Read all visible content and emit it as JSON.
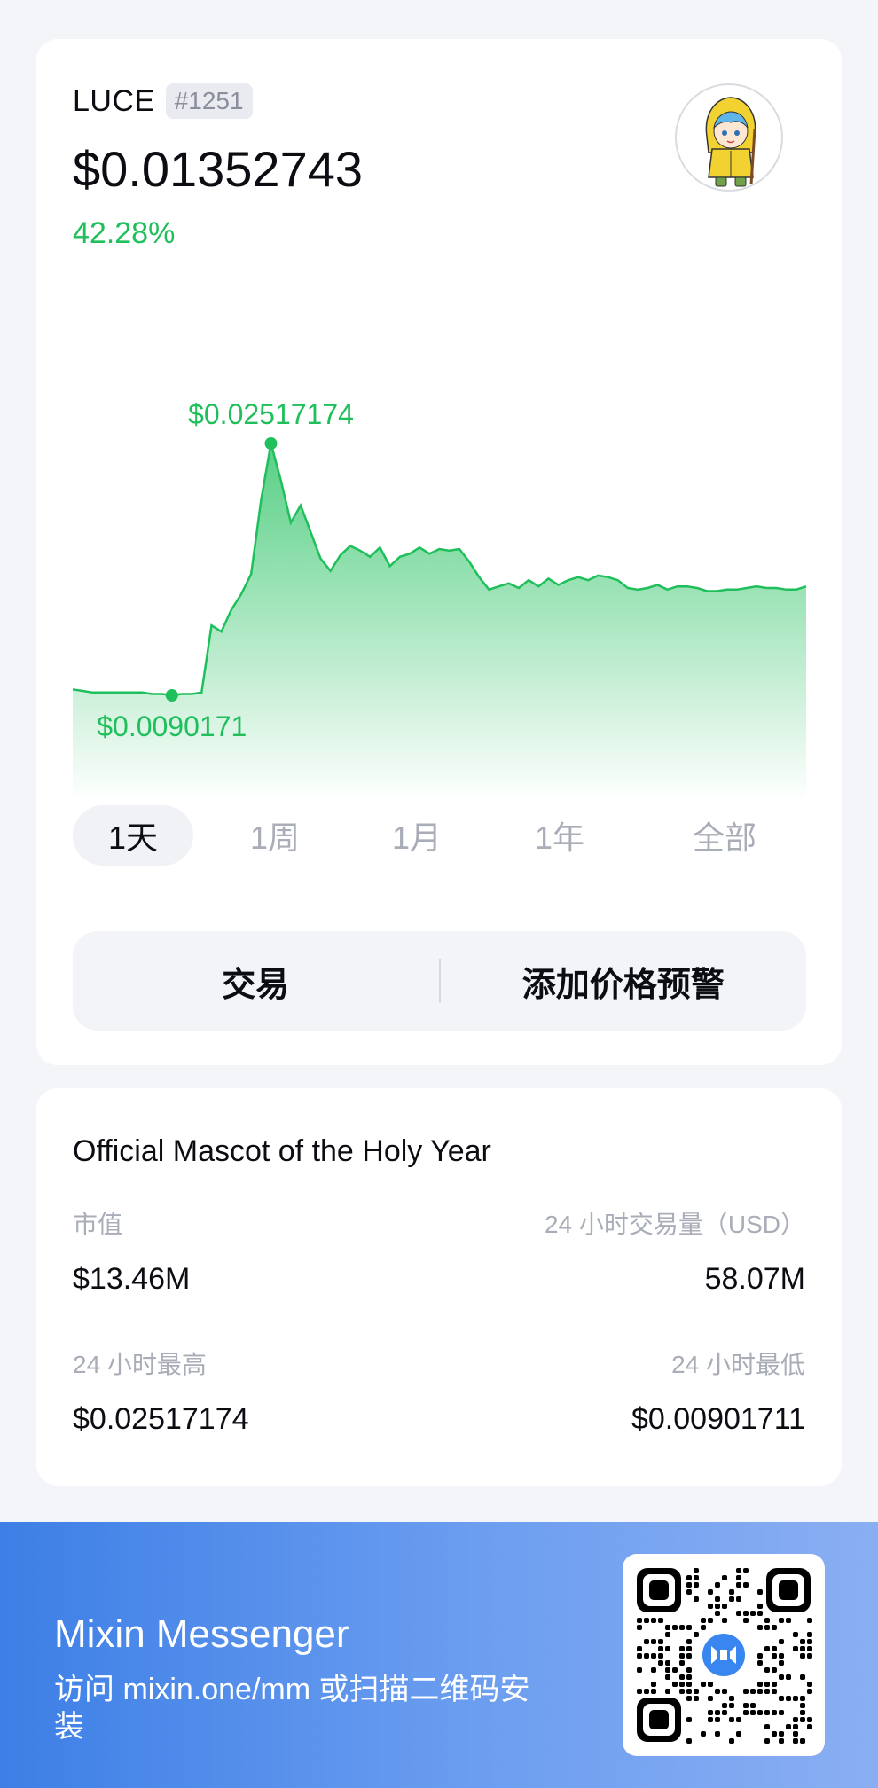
{
  "coin": {
    "symbol": "LUCE",
    "rank": "#1251",
    "price": "$0.01352743",
    "change": "42.28%",
    "avatar_icon": "mascot-avatar"
  },
  "chart_data": {
    "type": "area",
    "color": "#1fbf5b",
    "max_label": "$0.02517174",
    "min_label": "$0.0090171",
    "max_value": 0.02517174,
    "min_value": 0.0090171,
    "series": [
      {
        "values": [
          0.0094,
          0.0093,
          0.0092,
          0.0092,
          0.0092,
          0.0092,
          0.0092,
          0.0092,
          0.0091,
          0.0091,
          0.0090171,
          0.0091,
          0.0091,
          0.0092,
          0.0135,
          0.0131,
          0.0145,
          0.0155,
          0.0168,
          0.0215,
          0.02517174,
          0.0228,
          0.0201,
          0.0212,
          0.0195,
          0.0178,
          0.017,
          0.018,
          0.0186,
          0.0183,
          0.0179,
          0.0185,
          0.0173,
          0.0179,
          0.0181,
          0.0185,
          0.0181,
          0.0184,
          0.0183,
          0.0184,
          0.0176,
          0.0166,
          0.0158,
          0.016,
          0.0162,
          0.0159,
          0.0164,
          0.016,
          0.0165,
          0.0161,
          0.0164,
          0.0166,
          0.0164,
          0.0167,
          0.0166,
          0.0164,
          0.0159,
          0.0158,
          0.0159,
          0.0161,
          0.0158,
          0.016,
          0.016,
          0.0159,
          0.0157,
          0.0157,
          0.0158,
          0.0158,
          0.0159,
          0.016,
          0.0159,
          0.0159,
          0.0158,
          0.0158,
          0.016
        ]
      }
    ]
  },
  "ranges": [
    "1天",
    "1周",
    "1月",
    "1年",
    "全部"
  ],
  "active_range": "1天",
  "actions": {
    "trade": "交易",
    "alert": "添加价格预警"
  },
  "info": {
    "title": "Official Mascot of the Holy Year",
    "market_cap_label": "市值",
    "market_cap_value": "$13.46M",
    "volume_label": "24 小时交易量（USD）",
    "volume_value": "58.07M",
    "high_label": "24 小时最高",
    "high_value": "$0.02517174",
    "low_label": "24 小时最低",
    "low_value": "$0.00901711"
  },
  "footer": {
    "title": "Mixin Messenger",
    "subtitle": "访问 mixin.one/mm 或扫描二维码安装",
    "qr_icon": "qr-code",
    "logo_icon": "mixin-logo"
  }
}
